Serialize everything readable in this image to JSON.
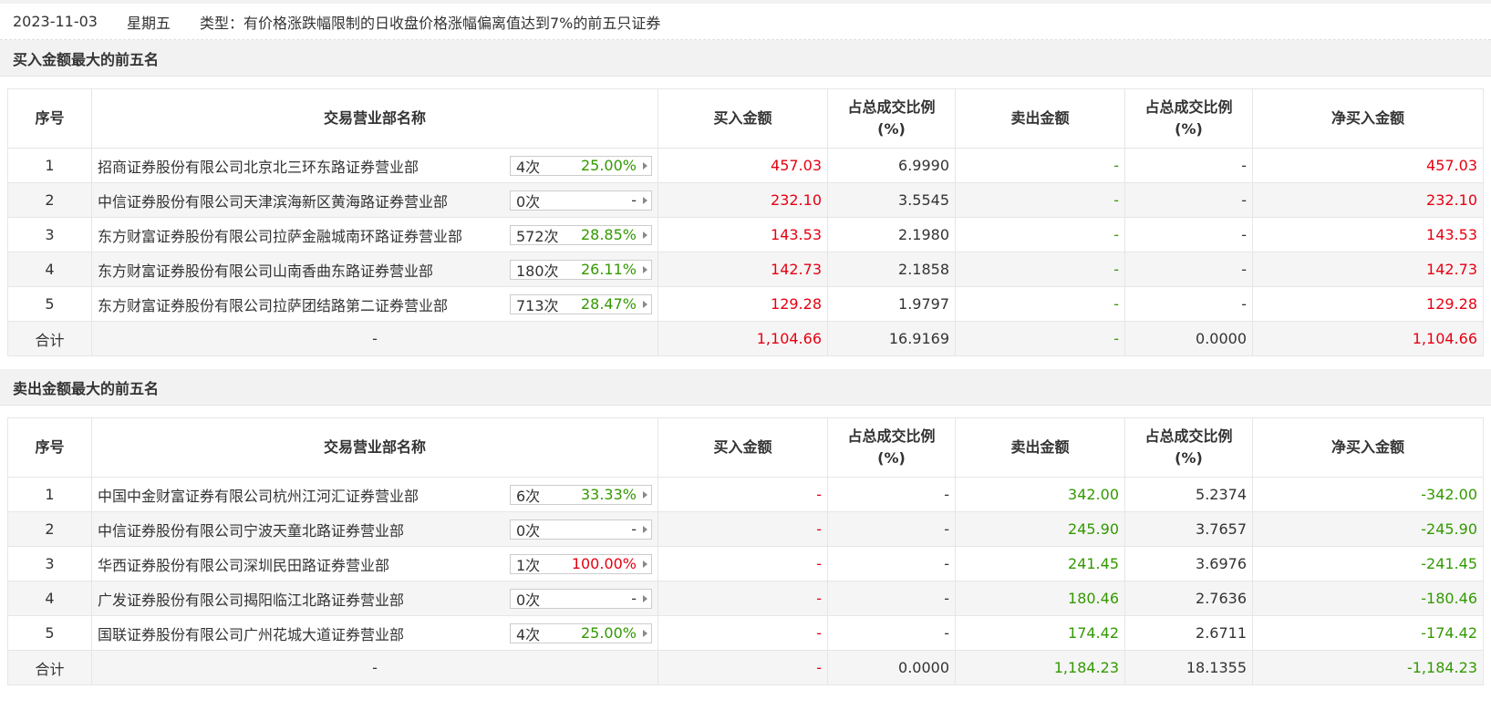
{
  "header": {
    "date": "2023-11-03",
    "weekday": "星期五",
    "type_label": "类型：有价格涨跌幅限制的日收盘价格涨幅偏离值达到7%的前五只证券"
  },
  "columns": [
    "序号",
    "交易营业部名称",
    "买入金额",
    "占总成交比例\n(%)",
    "卖出金额",
    "占总成交比例\n(%)",
    "净买入金额"
  ],
  "buy_section": {
    "title": "买入金额最大的前五名",
    "rows": [
      {
        "idx": "1",
        "name": "招商证券股份有限公司北京北三环东路证券营业部",
        "count": "4次",
        "pct": "25.00%",
        "pct_color": "green",
        "buy": "457.03",
        "buy_ratio": "6.9990",
        "sell": "-",
        "sell_ratio": "-",
        "net": "457.03"
      },
      {
        "idx": "2",
        "name": "中信证券股份有限公司天津滨海新区黄海路证券营业部",
        "count": "0次",
        "pct": "-",
        "pct_color": "black",
        "buy": "232.10",
        "buy_ratio": "3.5545",
        "sell": "-",
        "sell_ratio": "-",
        "net": "232.10"
      },
      {
        "idx": "3",
        "name": "东方财富证券股份有限公司拉萨金融城南环路证券营业部",
        "count": "572次",
        "pct": "28.85%",
        "pct_color": "green",
        "buy": "143.53",
        "buy_ratio": "2.1980",
        "sell": "-",
        "sell_ratio": "-",
        "net": "143.53"
      },
      {
        "idx": "4",
        "name": "东方财富证券股份有限公司山南香曲东路证券营业部",
        "count": "180次",
        "pct": "26.11%",
        "pct_color": "green",
        "buy": "142.73",
        "buy_ratio": "2.1858",
        "sell": "-",
        "sell_ratio": "-",
        "net": "142.73"
      },
      {
        "idx": "5",
        "name": "东方财富证券股份有限公司拉萨团结路第二证券营业部",
        "count": "713次",
        "pct": "28.47%",
        "pct_color": "green",
        "buy": "129.28",
        "buy_ratio": "1.9797",
        "sell": "-",
        "sell_ratio": "-",
        "net": "129.28"
      }
    ],
    "total": {
      "idx": "合计",
      "name": "-",
      "buy": "1,104.66",
      "buy_ratio": "16.9169",
      "sell": "-",
      "sell_ratio": "0.0000",
      "net": "1,104.66"
    }
  },
  "sell_section": {
    "title": "卖出金额最大的前五名",
    "rows": [
      {
        "idx": "1",
        "name": "中国中金财富证券有限公司杭州江河汇证券营业部",
        "count": "6次",
        "pct": "33.33%",
        "pct_color": "green",
        "buy": "-",
        "buy_ratio": "-",
        "sell": "342.00",
        "sell_ratio": "5.2374",
        "net": "-342.00"
      },
      {
        "idx": "2",
        "name": "中信证券股份有限公司宁波天童北路证券营业部",
        "count": "0次",
        "pct": "-",
        "pct_color": "black",
        "buy": "-",
        "buy_ratio": "-",
        "sell": "245.90",
        "sell_ratio": "3.7657",
        "net": "-245.90"
      },
      {
        "idx": "3",
        "name": "华西证券股份有限公司深圳民田路证券营业部",
        "count": "1次",
        "pct": "100.00%",
        "pct_color": "red",
        "buy": "-",
        "buy_ratio": "-",
        "sell": "241.45",
        "sell_ratio": "3.6976",
        "net": "-241.45"
      },
      {
        "idx": "4",
        "name": "广发证券股份有限公司揭阳临江北路证券营业部",
        "count": "0次",
        "pct": "-",
        "pct_color": "black",
        "buy": "-",
        "buy_ratio": "-",
        "sell": "180.46",
        "sell_ratio": "2.7636",
        "net": "-180.46"
      },
      {
        "idx": "5",
        "name": "国联证券股份有限公司广州花城大道证券营业部",
        "count": "4次",
        "pct": "25.00%",
        "pct_color": "green",
        "buy": "-",
        "buy_ratio": "-",
        "sell": "174.42",
        "sell_ratio": "2.6711",
        "net": "-174.42"
      }
    ],
    "total": {
      "idx": "合计",
      "name": "-",
      "buy": "-",
      "buy_ratio": "0.0000",
      "sell": "1,184.23",
      "sell_ratio": "18.1355",
      "net": "-1,184.23"
    }
  },
  "colors": {
    "red": "#e60012",
    "green": "#339900",
    "header_bg": "#f2f2f2",
    "alt_row": "#f5f5f5"
  }
}
